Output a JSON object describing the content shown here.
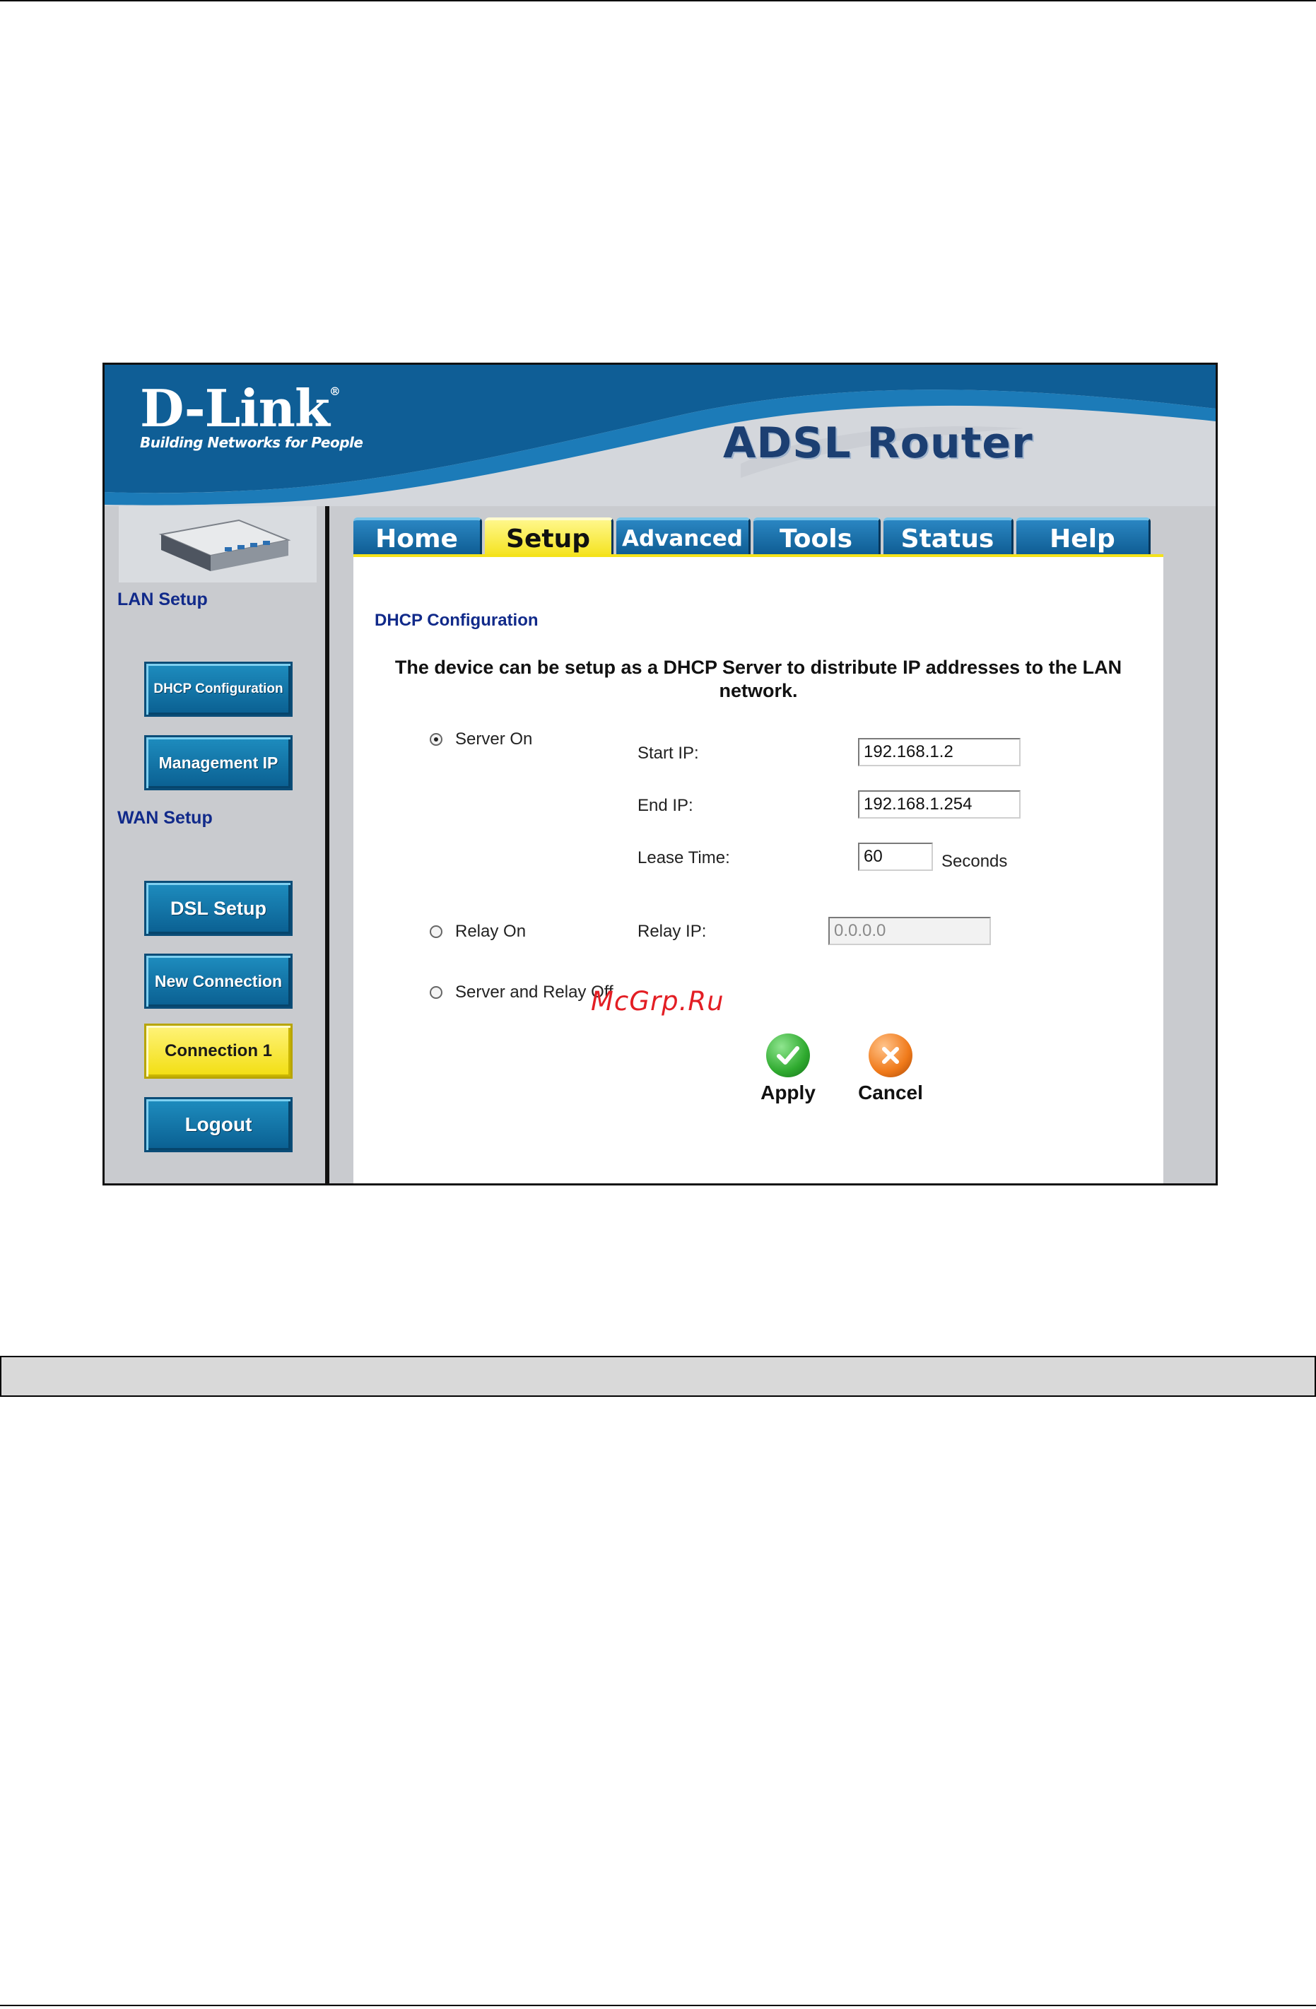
{
  "banner": {
    "logo": "D-Link",
    "logo_reg": "®",
    "tagline": "Building Networks for People",
    "product": "ADSL Router"
  },
  "tabs": [
    {
      "label": "Home"
    },
    {
      "label": "Setup",
      "active": true
    },
    {
      "label": "Advanced"
    },
    {
      "label": "Tools"
    },
    {
      "label": "Status"
    },
    {
      "label": "Help"
    }
  ],
  "sidebar": {
    "lan_heading": "LAN Setup",
    "wan_heading": "WAN Setup",
    "buttons": [
      {
        "label": "DHCP Configuration"
      },
      {
        "label": "Management IP"
      },
      {
        "label": "DSL Setup"
      },
      {
        "label": "New Connection"
      },
      {
        "label": "Connection 1",
        "active": true
      },
      {
        "label": "Logout"
      }
    ]
  },
  "content": {
    "title": "DHCP Configuration",
    "description": "The device can be setup as a DHCP Server to distribute IP addresses to the LAN network.",
    "server_on": {
      "label": "Server On",
      "selected": true
    },
    "relay_on": {
      "label": "Relay On",
      "selected": false
    },
    "server_relay_off": {
      "label": "Server and Relay Off",
      "selected": false
    },
    "start_ip": {
      "label": "Start IP:",
      "value": "192.168.1.2"
    },
    "end_ip": {
      "label": "End IP:",
      "value": "192.168.1.254"
    },
    "lease_time": {
      "label": "Lease Time:",
      "value": "60",
      "unit": "Seconds"
    },
    "relay_ip": {
      "label": "Relay IP:",
      "value": "0.0.0.0"
    },
    "apply_label": "Apply",
    "cancel_label": "Cancel"
  },
  "watermark": "McGrp.Ru",
  "colors": {
    "banner_blue": "#0f5e96",
    "tab_blue": "#1570ad",
    "active_yellow": "#f4e21b",
    "heading_navy": "#112a8a",
    "apply_green": "#2faa2f",
    "cancel_orange": "#f07a1a"
  },
  "icons": [
    "checkmark-icon",
    "x-mark-icon",
    "router-device-icon"
  ]
}
